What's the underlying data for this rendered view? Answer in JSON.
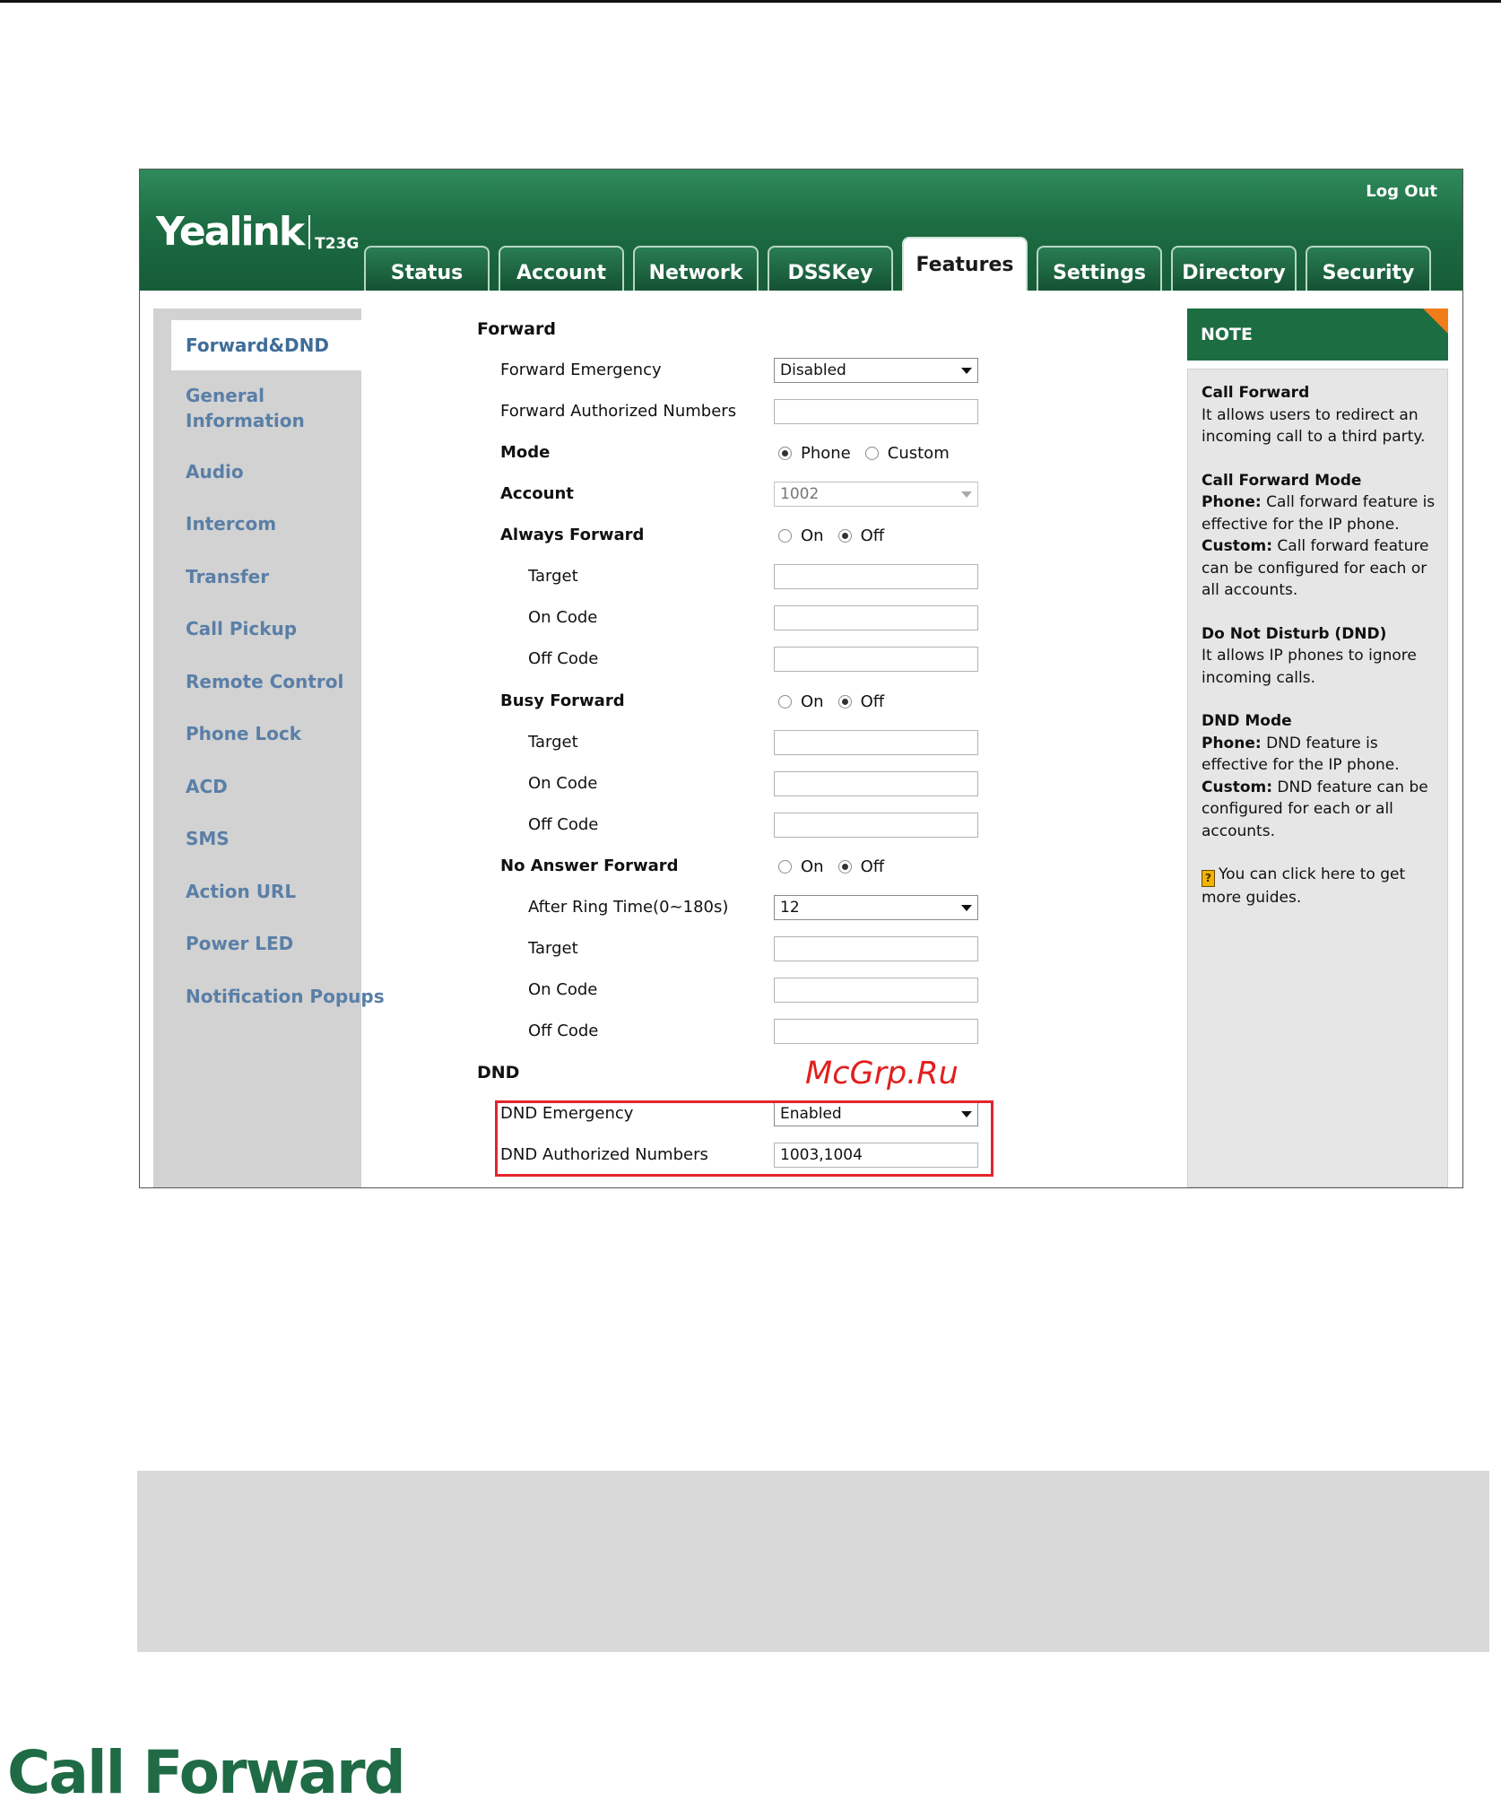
{
  "header": {
    "brand": "Yealink",
    "model": "T23G",
    "logout_label": "Log Out",
    "tabs": [
      "Status",
      "Account",
      "Network",
      "DSSKey",
      "Features",
      "Settings",
      "Directory",
      "Security"
    ],
    "active_tab": "Features"
  },
  "sidebar": {
    "items": [
      "Forward&DND",
      "General Information",
      "Audio",
      "Intercom",
      "Transfer",
      "Call Pickup",
      "Remote Control",
      "Phone Lock",
      "ACD",
      "SMS",
      "Action URL",
      "Power LED",
      "Notification Popups"
    ],
    "active": "Forward&DND"
  },
  "form": {
    "forward_title": "Forward",
    "forward_emergency": {
      "label": "Forward Emergency",
      "value": "Disabled"
    },
    "forward_authorized": {
      "label": "Forward Authorized Numbers",
      "value": ""
    },
    "mode": {
      "label": "Mode",
      "options": [
        "Phone",
        "Custom"
      ],
      "selected": "Phone"
    },
    "account": {
      "label": "Account",
      "value": "1002"
    },
    "always_forward": {
      "label": "Always Forward",
      "options": [
        "On",
        "Off"
      ],
      "selected": "Off",
      "target_label": "Target",
      "on_code_label": "On Code",
      "off_code_label": "Off Code"
    },
    "busy_forward": {
      "label": "Busy Forward",
      "options": [
        "On",
        "Off"
      ],
      "selected": "Off",
      "target_label": "Target",
      "on_code_label": "On Code",
      "off_code_label": "Off Code"
    },
    "no_answer_forward": {
      "label": "No Answer Forward",
      "options": [
        "On",
        "Off"
      ],
      "selected": "Off",
      "ring_time_label": "After Ring Time(0~180s)",
      "ring_time_value": "12",
      "target_label": "Target",
      "on_code_label": "On Code",
      "off_code_label": "Off Code"
    },
    "dnd_title": "DND",
    "dnd_emergency": {
      "label": "DND Emergency",
      "value": "Enabled"
    },
    "dnd_authorized": {
      "label": "DND Authorized Numbers",
      "value": "1003,1004"
    }
  },
  "note": {
    "title": "NOTE",
    "call_forward_title": "Call Forward",
    "call_forward_text": "It allows users to redirect an incoming call to a third party.",
    "cf_mode_title": "Call Forward Mode",
    "cf_phone_label": "Phone:",
    "cf_phone_text": "Call forward feature is effective for the IP phone.",
    "cf_custom_label": "Custom:",
    "cf_custom_text": "Call forward feature can be configured for each or all accounts.",
    "dnd_title": "Do Not Disturb (DND)",
    "dnd_text": "It allows IP phones to ignore incoming calls.",
    "dnd_mode_title": "DND Mode",
    "dnd_phone_label": "Phone:",
    "dnd_phone_text": "DND feature is effective for the IP phone.",
    "dnd_custom_label": "Custom:",
    "dnd_custom_text": "DND feature can be configured for each or all accounts.",
    "guide_text": "You can click here to get more guides."
  },
  "watermark": "McGrp.Ru",
  "page_heading": "Call Forward",
  "colors": {
    "brand_green": "#1d6d43",
    "highlight_red": "#e2262c",
    "note_corner": "#f07d1a",
    "link_blue": "#5a7fa7"
  }
}
